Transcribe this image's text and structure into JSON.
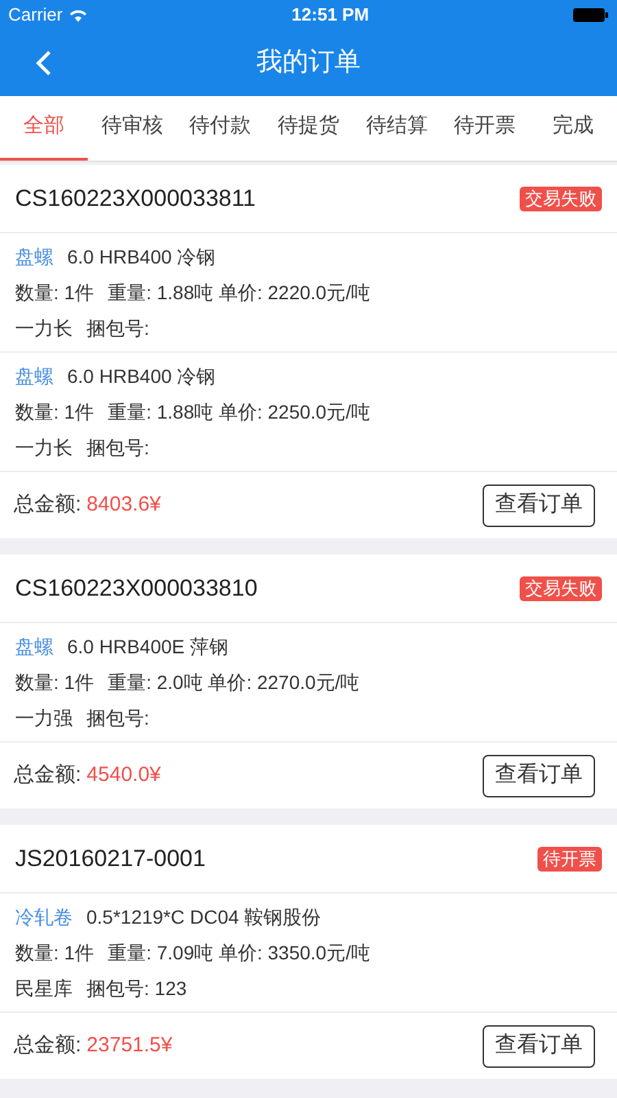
{
  "status_bar": {
    "carrier": "Carrier",
    "time": "12:51 PM"
  },
  "nav": {
    "title": "我的订单"
  },
  "tabs": [
    {
      "label": "全部",
      "selected": true
    },
    {
      "label": "待审核",
      "selected": false
    },
    {
      "label": "待付款",
      "selected": false
    },
    {
      "label": "待提货",
      "selected": false
    },
    {
      "label": "待结算",
      "selected": false
    },
    {
      "label": "待开票",
      "selected": false
    },
    {
      "label": "完成",
      "selected": false
    }
  ],
  "orders": [
    {
      "number": "CS160223X000033811",
      "status": "交易失败",
      "items": [
        {
          "category": "盘螺",
          "spec": "6.0  HRB400 冷钢",
          "quantity": "数量: 1件",
          "weight_price": "重量: 1.88吨 单价: 2220.0元/吨",
          "warehouse": "一力长",
          "bundle": "捆包号:"
        },
        {
          "category": "盘螺",
          "spec": "6.0  HRB400 冷钢",
          "quantity": "数量: 1件",
          "weight_price": "重量: 1.88吨 单价: 2250.0元/吨",
          "warehouse": "一力长",
          "bundle": "捆包号:"
        }
      ],
      "total_label": "总金额:",
      "total": "8403.6¥",
      "button": "查看订单"
    },
    {
      "number": "CS160223X000033810",
      "status": "交易失败",
      "items": [
        {
          "category": "盘螺",
          "spec": "6.0  HRB400E 萍钢",
          "quantity": "数量: 1件",
          "weight_price": "重量: 2.0吨 单价: 2270.0元/吨",
          "warehouse": "一力强",
          "bundle": "捆包号:"
        }
      ],
      "total_label": "总金额:",
      "total": "4540.0¥",
      "button": "查看订单"
    },
    {
      "number": "JS20160217-0001",
      "status": "待开票",
      "items": [
        {
          "category": "冷轧卷",
          "spec": "0.5*1219*C  DC04 鞍钢股份",
          "quantity": "数量: 1件",
          "weight_price": "重量: 7.09吨 单价: 3350.0元/吨",
          "warehouse": "民星库",
          "bundle": "捆包号: 123"
        }
      ],
      "total_label": "总金额:",
      "total": "23751.5¥",
      "button": "查看订单"
    }
  ]
}
